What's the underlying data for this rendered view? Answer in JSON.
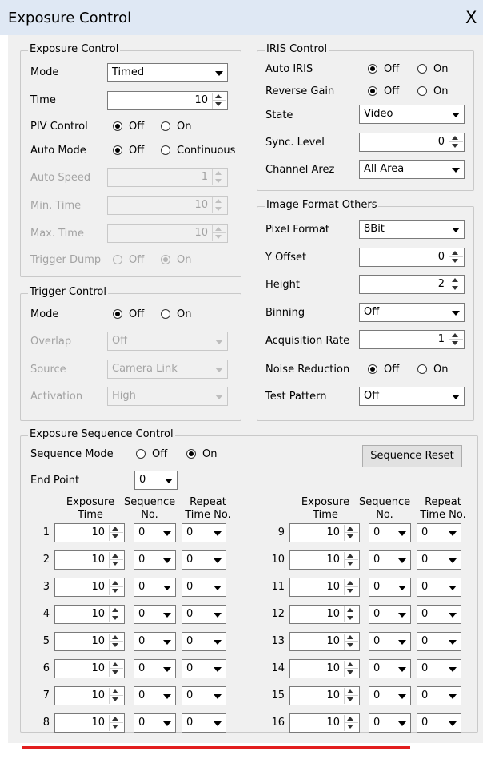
{
  "window": {
    "title": "Exposure Control",
    "close_glyph": "X"
  },
  "exposure_control": {
    "legend": "Exposure Control",
    "mode_label": "Mode",
    "mode_value": "Timed",
    "time_label": "Time",
    "time_value": "10",
    "piv_label": "PIV Control",
    "piv_off": "Off",
    "piv_on": "On",
    "auto_mode_label": "Auto Mode",
    "auto_mode_off": "Off",
    "auto_mode_continuous": "Continuous",
    "auto_speed_label": "Auto Speed",
    "auto_speed_value": "1",
    "min_time_label": "Min. Time",
    "min_time_value": "10",
    "max_time_label": "Max. Time",
    "max_time_value": "10",
    "trigger_dump_label": "Trigger Dump",
    "trigger_dump_off": "Off",
    "trigger_dump_on": "On"
  },
  "trigger_control": {
    "legend": "Trigger Control",
    "mode_label": "Mode",
    "mode_off": "Off",
    "mode_on": "On",
    "overlap_label": "Overlap",
    "overlap_value": "Off",
    "source_label": "Source",
    "source_value": "Camera Link",
    "activation_label": "Activation",
    "activation_value": "High"
  },
  "iris_control": {
    "legend": "IRIS Control",
    "auto_iris_label": "Auto IRIS",
    "auto_iris_off": "Off",
    "auto_iris_on": "On",
    "reverse_gain_label": "Reverse Gain",
    "reverse_gain_off": "Off",
    "reverse_gain_on": "On",
    "state_label": "State",
    "state_value": "Video",
    "sync_level_label": "Sync. Level",
    "sync_level_value": "0",
    "channel_area_label": "Channel Arez",
    "channel_area_value": "All Area"
  },
  "image_format": {
    "legend": "Image Format  Others",
    "pixel_format_label": "Pixel Format",
    "pixel_format_value": "8Bit",
    "y_offset_label": "Y Offset",
    "y_offset_value": "0",
    "height_label": "Height",
    "height_value": "2",
    "binning_label": "Binning",
    "binning_value": "Off",
    "acquisition_rate_label": "Acquisition Rate",
    "acquisition_rate_value": "1",
    "noise_reduction_label": "Noise Reduction",
    "noise_reduction_off": "Off",
    "noise_reduction_on": "On",
    "test_pattern_label": "Test Pattern",
    "test_pattern_value": "Off"
  },
  "sequence": {
    "legend": "Exposure Sequence Control",
    "mode_label": "Sequence Mode",
    "mode_off": "Off",
    "mode_on": "On",
    "reset_label": "Sequence Reset",
    "end_point_label": "End Point",
    "end_point_value": "0",
    "headers": {
      "exposure_1": "Exposure",
      "exposure_2": "Time",
      "sequence_1": "Sequence",
      "sequence_2": "No.",
      "repeat_1": "Repeat",
      "repeat_2": "Time No."
    },
    "rows": [
      {
        "n": "1",
        "exposure": "10",
        "sequence": "0",
        "repeat": "0"
      },
      {
        "n": "2",
        "exposure": "10",
        "sequence": "0",
        "repeat": "0"
      },
      {
        "n": "3",
        "exposure": "10",
        "sequence": "0",
        "repeat": "0"
      },
      {
        "n": "4",
        "exposure": "10",
        "sequence": "0",
        "repeat": "0"
      },
      {
        "n": "5",
        "exposure": "10",
        "sequence": "0",
        "repeat": "0"
      },
      {
        "n": "6",
        "exposure": "10",
        "sequence": "0",
        "repeat": "0"
      },
      {
        "n": "7",
        "exposure": "10",
        "sequence": "0",
        "repeat": "0"
      },
      {
        "n": "8",
        "exposure": "10",
        "sequence": "0",
        "repeat": "0"
      },
      {
        "n": "9",
        "exposure": "10",
        "sequence": "0",
        "repeat": "0"
      },
      {
        "n": "10",
        "exposure": "10",
        "sequence": "0",
        "repeat": "0"
      },
      {
        "n": "11",
        "exposure": "10",
        "sequence": "0",
        "repeat": "0"
      },
      {
        "n": "12",
        "exposure": "10",
        "sequence": "0",
        "repeat": "0"
      },
      {
        "n": "13",
        "exposure": "10",
        "sequence": "0",
        "repeat": "0"
      },
      {
        "n": "14",
        "exposure": "10",
        "sequence": "0",
        "repeat": "0"
      },
      {
        "n": "15",
        "exposure": "10",
        "sequence": "0",
        "repeat": "0"
      },
      {
        "n": "16",
        "exposure": "10",
        "sequence": "0",
        "repeat": "0"
      }
    ]
  },
  "colors": {
    "titlebar": "#dfe8f4",
    "dialog": "#f0f0f0",
    "bottom_line": "#e21e1e"
  }
}
